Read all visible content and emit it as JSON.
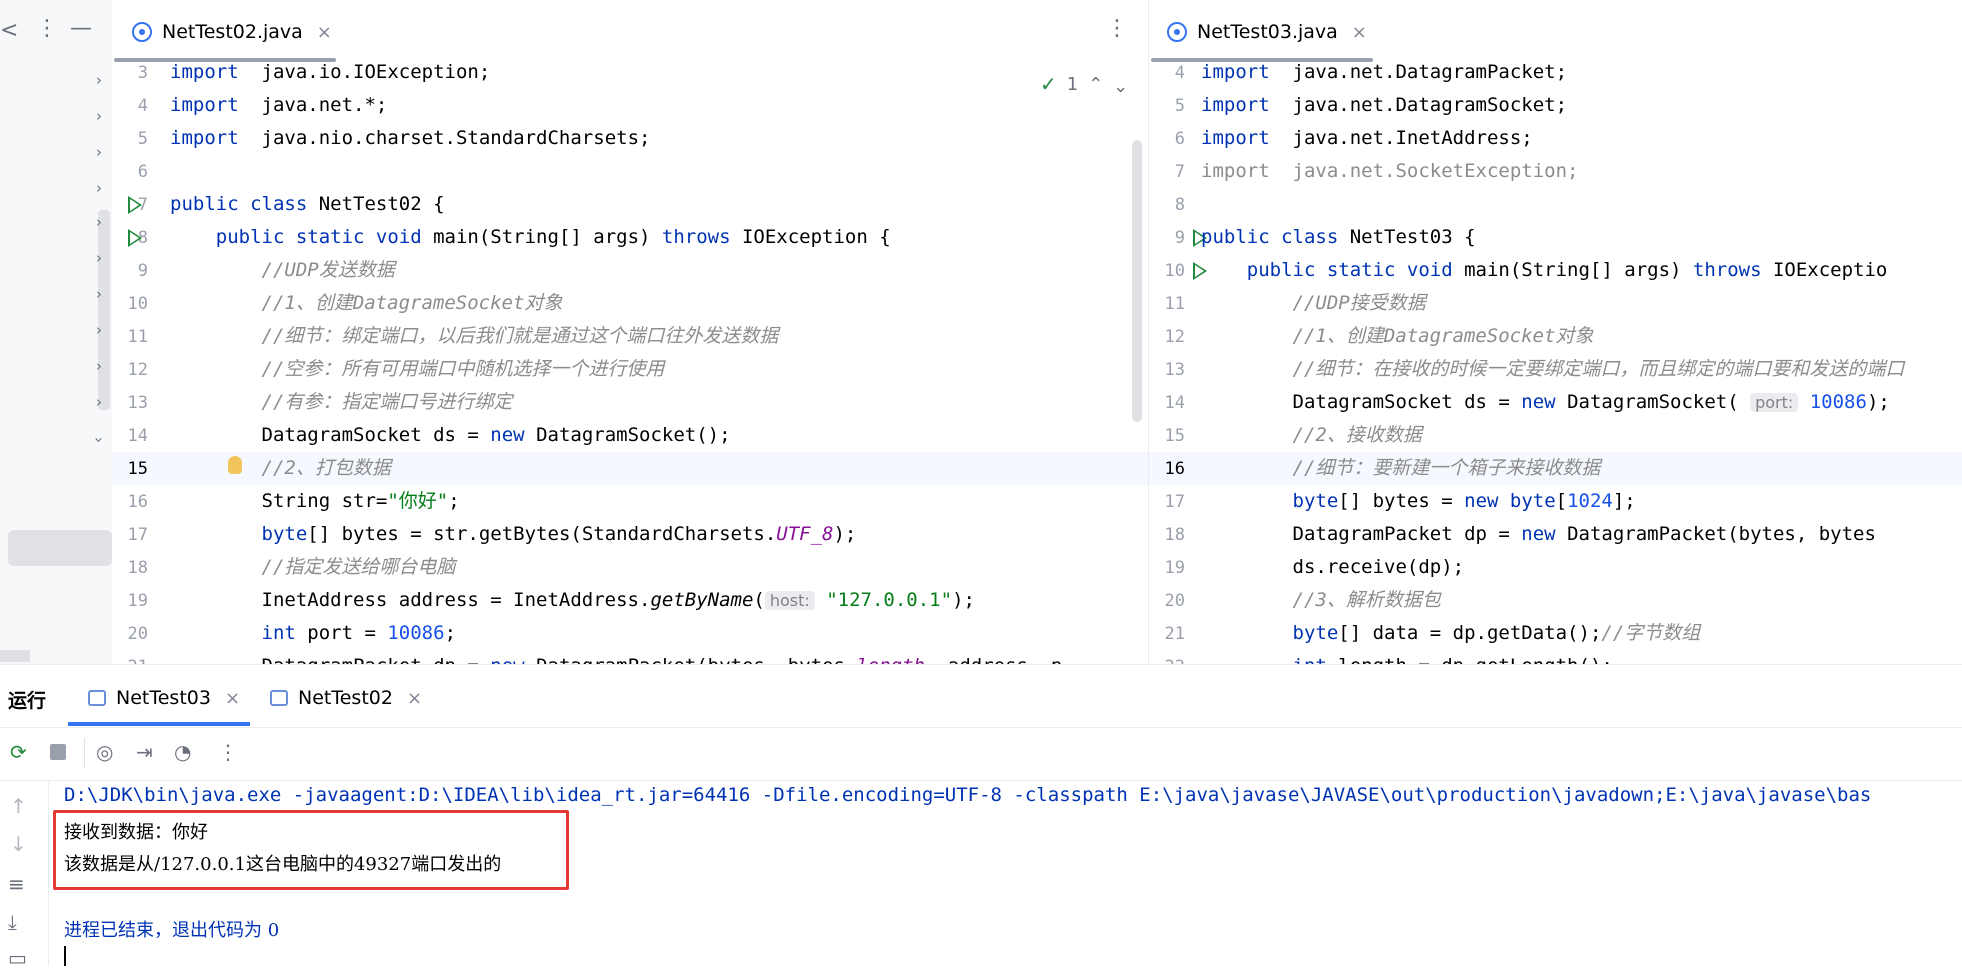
{
  "window_controls": {
    "back": "<",
    "more": "⋮",
    "minimize": "—"
  },
  "left_editor": {
    "tab_label": "NetTest02.java",
    "tab_close": "×",
    "tab_menu": "⋮",
    "inspection": {
      "count": "1"
    },
    "lines": [
      {
        "n": "3",
        "t": [
          [
            "kw",
            "import"
          ],
          [
            "",
            "  java.io.IOException;"
          ]
        ]
      },
      {
        "n": "4",
        "t": [
          [
            "kw",
            "import"
          ],
          [
            "",
            "  java.net.*;"
          ]
        ]
      },
      {
        "n": "5",
        "t": [
          [
            "kw",
            "import"
          ],
          [
            "",
            "  java.nio.charset.StandardCharsets;"
          ]
        ]
      },
      {
        "n": "6",
        "t": []
      },
      {
        "n": "7",
        "t": [
          [
            "kw",
            "public class"
          ],
          [
            "",
            " NetTest02 {"
          ]
        ]
      },
      {
        "n": "8",
        "t": [
          [
            "",
            "    "
          ],
          [
            "kw",
            "public static void"
          ],
          [
            "",
            " main(String[] args) "
          ],
          [
            "kw",
            "throws"
          ],
          [
            "",
            " IOException {"
          ]
        ]
      },
      {
        "n": "9",
        "t": [
          [
            "",
            "        "
          ],
          [
            "cm",
            "//UDP发送数据"
          ]
        ]
      },
      {
        "n": "10",
        "t": [
          [
            "",
            "        "
          ],
          [
            "cm",
            "//1、创建DatagrameSocket对象"
          ]
        ]
      },
      {
        "n": "11",
        "t": [
          [
            "",
            "        "
          ],
          [
            "cm",
            "//细节：绑定端口，以后我们就是通过这个端口往外发送数据"
          ]
        ]
      },
      {
        "n": "12",
        "t": [
          [
            "",
            "        "
          ],
          [
            "cm",
            "//空参：所有可用端口中随机选择一个进行使用"
          ]
        ]
      },
      {
        "n": "13",
        "t": [
          [
            "",
            "        "
          ],
          [
            "cm",
            "//有参：指定端口号进行绑定"
          ]
        ]
      },
      {
        "n": "14",
        "t": [
          [
            "",
            "        DatagramSocket ds = "
          ],
          [
            "kw",
            "new"
          ],
          [
            "",
            " DatagramSocket();"
          ]
        ]
      },
      {
        "n": "15",
        "t": [
          [
            "",
            "        "
          ],
          [
            "cm",
            "//2、打包数据"
          ]
        ]
      },
      {
        "n": "16",
        "t": [
          [
            "",
            "        String str="
          ],
          [
            "str",
            "\"你好\""
          ],
          [
            "",
            ";"
          ]
        ]
      },
      {
        "n": "17",
        "t": [
          [
            "",
            "        "
          ],
          [
            "kw",
            "byte"
          ],
          [
            "",
            "[] bytes = str.getBytes(StandardCharsets."
          ],
          [
            "it",
            "UTF_8"
          ],
          [
            "",
            ");"
          ]
        ]
      },
      {
        "n": "18",
        "t": [
          [
            "",
            "        "
          ],
          [
            "cm",
            "//指定发送给哪台电脑"
          ]
        ]
      },
      {
        "n": "19",
        "t": [
          [
            "",
            "        InetAddress address = InetAddress."
          ],
          [
            "fit",
            "getByName"
          ],
          [
            "",
            "("
          ],
          [
            "hint",
            "host:"
          ],
          [
            "",
            " "
          ],
          [
            "str",
            "\"127.0.0.1\""
          ],
          [
            "",
            ");"
          ]
        ]
      },
      {
        "n": "20",
        "t": [
          [
            "",
            "        "
          ],
          [
            "kw",
            "int"
          ],
          [
            "",
            " port = "
          ],
          [
            "num",
            "10086"
          ],
          [
            "",
            ";"
          ]
        ]
      },
      {
        "n": "21",
        "t": [
          [
            "",
            "        DatagramPacket dp = "
          ],
          [
            "kw",
            "new"
          ],
          [
            "",
            " DatagramPacket(bytes, bytes."
          ],
          [
            "it",
            "length"
          ],
          [
            "",
            ", address, p"
          ]
        ]
      }
    ]
  },
  "right_editor": {
    "tab_label": "NetTest03.java",
    "tab_close": "×",
    "lines": [
      {
        "n": "4",
        "t": [
          [
            "kw",
            "import"
          ],
          [
            "",
            "  java.net.DatagramPacket;"
          ]
        ]
      },
      {
        "n": "5",
        "t": [
          [
            "kw",
            "import"
          ],
          [
            "",
            "  java.net.DatagramSocket;"
          ]
        ]
      },
      {
        "n": "6",
        "t": [
          [
            "kw",
            "import"
          ],
          [
            "",
            "  java.net.InetAddress;"
          ]
        ]
      },
      {
        "n": "7",
        "t": [
          [
            "cm2",
            "import  java.net.SocketException;"
          ]
        ]
      },
      {
        "n": "8",
        "t": []
      },
      {
        "n": "9",
        "t": [
          [
            "kw",
            "public class"
          ],
          [
            "",
            " NetTest03 {"
          ]
        ]
      },
      {
        "n": "10",
        "t": [
          [
            "",
            "    "
          ],
          [
            "kw",
            "public static void"
          ],
          [
            "",
            " main(String[] args) "
          ],
          [
            "kw",
            "throws"
          ],
          [
            "",
            " IOExceptio"
          ]
        ]
      },
      {
        "n": "11",
        "t": [
          [
            "",
            "        "
          ],
          [
            "cm",
            "//UDP接受数据"
          ]
        ]
      },
      {
        "n": "12",
        "t": [
          [
            "",
            "        "
          ],
          [
            "cm",
            "//1、创建DatagrameSocket对象"
          ]
        ]
      },
      {
        "n": "13",
        "t": [
          [
            "",
            "        "
          ],
          [
            "cm",
            "//细节：在接收的时候一定要绑定端口，而且绑定的端口要和发送的端口"
          ]
        ]
      },
      {
        "n": "14",
        "t": [
          [
            "",
            "        DatagramSocket ds = "
          ],
          [
            "kw",
            "new"
          ],
          [
            "",
            " DatagramSocket( "
          ],
          [
            "hint",
            "port:"
          ],
          [
            "",
            " "
          ],
          [
            "num",
            "10086"
          ],
          [
            "",
            ");"
          ]
        ]
      },
      {
        "n": "15",
        "t": [
          [
            "",
            "        "
          ],
          [
            "cm",
            "//2、接收数据"
          ]
        ]
      },
      {
        "n": "16",
        "t": [
          [
            "",
            "        "
          ],
          [
            "cm",
            "//细节：要新建一个箱子来接收数据"
          ]
        ]
      },
      {
        "n": "17",
        "t": [
          [
            "",
            "        "
          ],
          [
            "kw",
            "byte"
          ],
          [
            "",
            "[] bytes = "
          ],
          [
            "kw",
            "new byte"
          ],
          [
            "",
            "["
          ],
          [
            "num",
            "1024"
          ],
          [
            "",
            "];"
          ]
        ]
      },
      {
        "n": "18",
        "t": [
          [
            "",
            "        DatagramPacket dp = "
          ],
          [
            "kw",
            "new"
          ],
          [
            "",
            " DatagramPacket(bytes, bytes"
          ]
        ]
      },
      {
        "n": "19",
        "t": [
          [
            "",
            "        ds.receive(dp);"
          ]
        ]
      },
      {
        "n": "20",
        "t": [
          [
            "",
            "        "
          ],
          [
            "cm",
            "//3、解析数据包"
          ]
        ]
      },
      {
        "n": "21",
        "t": [
          [
            "",
            "        "
          ],
          [
            "kw",
            "byte"
          ],
          [
            "",
            "[] data = dp.getData();"
          ],
          [
            "cm",
            "//字节数组"
          ]
        ]
      },
      {
        "n": "22",
        "t": [
          [
            "",
            "        "
          ],
          [
            "kw",
            "int"
          ],
          [
            "",
            " length = dp.getLength();"
          ]
        ]
      }
    ]
  },
  "run_panel": {
    "title": "运行",
    "tabs": [
      {
        "label": "NetTest03",
        "close": "×"
      },
      {
        "label": "NetTest02",
        "close": "×"
      }
    ],
    "console": {
      "command": "D:\\JDK\\bin\\java.exe -javaagent:D:\\IDEA\\lib\\idea_rt.jar=64416 -Dfile.encoding=UTF-8 -classpath E:\\java\\javase\\JAVASE\\out\\production\\javadown;E:\\java\\javase\\bas",
      "output_line1": "接收到数据：你好",
      "output_line2": "该数据是从/127.0.0.1这台电脑中的49327端口发出的",
      "exit_line": "进程已结束，退出代码为 0"
    },
    "highlight_color": "#e53935"
  }
}
